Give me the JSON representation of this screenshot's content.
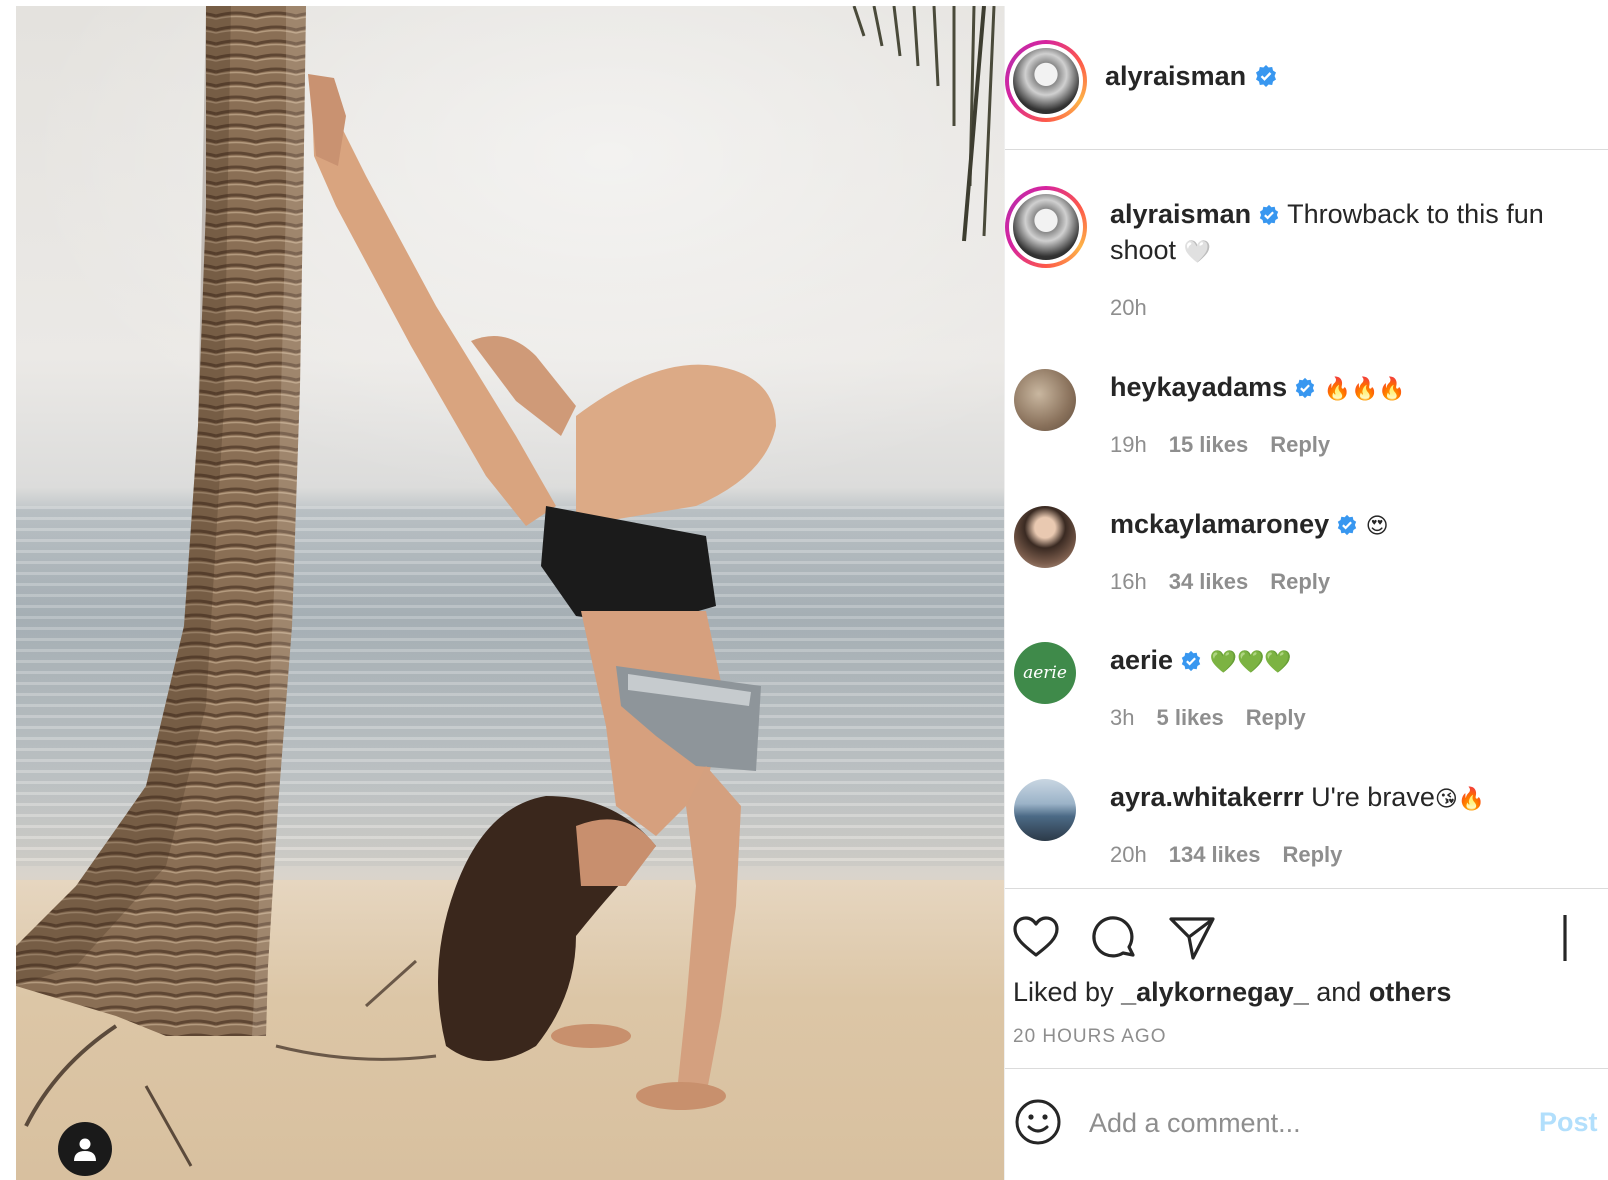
{
  "post": {
    "username": "alyraisman",
    "verified": true
  },
  "caption": {
    "username": "alyraisman",
    "text": "Throwback to this fun shoot",
    "emoji": "🤍",
    "time": "20h"
  },
  "comments": [
    {
      "username": "heykayadams",
      "verified": true,
      "text": "",
      "emoji": "🔥🔥🔥",
      "time": "19h",
      "likes": "15 likes",
      "reply": "Reply",
      "avatar_color": "#a08870"
    },
    {
      "username": "mckaylamaroney",
      "verified": true,
      "text": "",
      "emoji": "😍",
      "time": "16h",
      "likes": "34 likes",
      "reply": "Reply",
      "avatar_color": "#8a6a5a"
    },
    {
      "username": "aerie",
      "verified": true,
      "text": "",
      "emoji": "💚💚💚",
      "time": "3h",
      "likes": "5 likes",
      "reply": "Reply",
      "avatar_color": "#3f8a4a",
      "avatar_text": "aerie"
    },
    {
      "username": "ayra.whitakerrr",
      "verified": false,
      "text": "U're brave",
      "emoji": "😘🔥",
      "time": "20h",
      "likes": "134 likes",
      "reply": "Reply",
      "avatar_color": "#6a8fb0"
    }
  ],
  "actions": {
    "liked_prefix": "Liked by",
    "liked_user": "_alykornegay_",
    "liked_and": "and",
    "liked_others": "others",
    "time_ago": "20 HOURS AGO"
  },
  "add_comment": {
    "placeholder": "Add a comment...",
    "post_label": "Post"
  },
  "colors": {
    "verified": "#3897f0",
    "post_button": "#b2dffc",
    "aerie_green": "#3f8a4a"
  }
}
